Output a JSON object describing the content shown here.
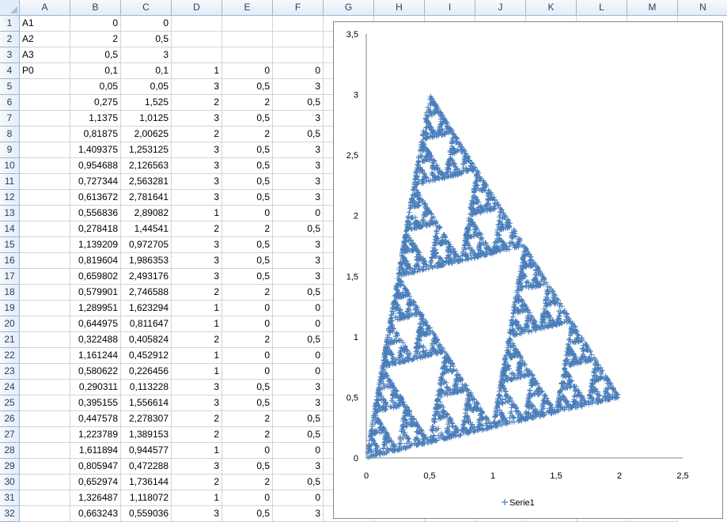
{
  "columns": [
    "A",
    "B",
    "C",
    "D",
    "E",
    "F",
    "G",
    "H",
    "I",
    "J",
    "K",
    "L",
    "M",
    "N"
  ],
  "rows": [
    [
      "A1",
      "0",
      "0",
      "",
      "",
      ""
    ],
    [
      "A2",
      "2",
      "0,5",
      "",
      "",
      ""
    ],
    [
      "A3",
      "0,5",
      "3",
      "",
      "",
      ""
    ],
    [
      "P0",
      "0,1",
      "0,1",
      "1",
      "0",
      "0"
    ],
    [
      "",
      "0,05",
      "0,05",
      "3",
      "0,5",
      "3"
    ],
    [
      "",
      "0,275",
      "1,525",
      "2",
      "2",
      "0,5"
    ],
    [
      "",
      "1,1375",
      "1,0125",
      "3",
      "0,5",
      "3"
    ],
    [
      "",
      "0,81875",
      "2,00625",
      "2",
      "2",
      "0,5"
    ],
    [
      "",
      "1,409375",
      "1,253125",
      "3",
      "0,5",
      "3"
    ],
    [
      "",
      "0,954688",
      "2,126563",
      "3",
      "0,5",
      "3"
    ],
    [
      "",
      "0,727344",
      "2,563281",
      "3",
      "0,5",
      "3"
    ],
    [
      "",
      "0,613672",
      "2,781641",
      "3",
      "0,5",
      "3"
    ],
    [
      "",
      "0,556836",
      "2,89082",
      "1",
      "0",
      "0"
    ],
    [
      "",
      "0,278418",
      "1,44541",
      "2",
      "2",
      "0,5"
    ],
    [
      "",
      "1,139209",
      "0,972705",
      "3",
      "0,5",
      "3"
    ],
    [
      "",
      "0,819604",
      "1,986353",
      "3",
      "0,5",
      "3"
    ],
    [
      "",
      "0,659802",
      "2,493176",
      "3",
      "0,5",
      "3"
    ],
    [
      "",
      "0,579901",
      "2,746588",
      "2",
      "2",
      "0,5"
    ],
    [
      "",
      "1,289951",
      "1,623294",
      "1",
      "0",
      "0"
    ],
    [
      "",
      "0,644975",
      "0,811647",
      "1",
      "0",
      "0"
    ],
    [
      "",
      "0,322488",
      "0,405824",
      "2",
      "2",
      "0,5"
    ],
    [
      "",
      "1,161244",
      "0,452912",
      "1",
      "0",
      "0"
    ],
    [
      "",
      "0,580622",
      "0,226456",
      "1",
      "0",
      "0"
    ],
    [
      "",
      "0,290311",
      "0,113228",
      "3",
      "0,5",
      "3"
    ],
    [
      "",
      "0,395155",
      "1,556614",
      "3",
      "0,5",
      "3"
    ],
    [
      "",
      "0,447578",
      "2,278307",
      "2",
      "2",
      "0,5"
    ],
    [
      "",
      "1,223789",
      "1,389153",
      "2",
      "2",
      "0,5"
    ],
    [
      "",
      "1,611894",
      "0,944577",
      "1",
      "0",
      "0"
    ],
    [
      "",
      "0,805947",
      "0,472288",
      "3",
      "0,5",
      "3"
    ],
    [
      "",
      "0,652974",
      "1,736144",
      "2",
      "2",
      "0,5"
    ],
    [
      "",
      "1,326487",
      "1,118072",
      "1",
      "0",
      "0"
    ],
    [
      "",
      "0,663243",
      "0,559036",
      "3",
      "0,5",
      "3"
    ]
  ],
  "chart_data": {
    "type": "scatter",
    "marker": "plus",
    "color": "#4a7ebb",
    "xlim": [
      0,
      2.5
    ],
    "ylim": [
      0,
      3.5
    ],
    "xticks": [
      "0",
      "0,5",
      "1",
      "1,5",
      "2",
      "2,5"
    ],
    "yticks": [
      "0",
      "0,5",
      "1",
      "1,5",
      "2",
      "2,5",
      "3",
      "3,5"
    ],
    "legend": "right-bottom",
    "series": [
      {
        "name": "Serie1",
        "vertices": [
          [
            0,
            0
          ],
          [
            2,
            0.5
          ],
          [
            0.5,
            3
          ]
        ],
        "start": [
          0.1,
          0.1
        ],
        "point_count": 5000,
        "sample_points": [
          [
            0.05,
            0.05
          ],
          [
            0.275,
            1.525
          ],
          [
            1.1375,
            1.0125
          ],
          [
            0.81875,
            2.00625
          ],
          [
            1.409375,
            1.253125
          ],
          [
            0.954688,
            2.126563
          ],
          [
            0.727344,
            2.563281
          ],
          [
            0.613672,
            2.781641
          ],
          [
            0.556836,
            2.89082
          ],
          [
            0.278418,
            1.44541
          ],
          [
            1.139209,
            0.972705
          ],
          [
            0.819604,
            1.986353
          ],
          [
            0.659802,
            2.493176
          ],
          [
            0.579901,
            2.746588
          ],
          [
            1.289951,
            1.623294
          ],
          [
            0.644975,
            0.811647
          ],
          [
            0.322488,
            0.405824
          ],
          [
            1.161244,
            0.452912
          ],
          [
            0.580622,
            0.226456
          ],
          [
            0.290311,
            0.113228
          ],
          [
            0.395155,
            1.556614
          ],
          [
            0.447578,
            2.278307
          ],
          [
            1.223789,
            1.389153
          ],
          [
            1.611894,
            0.944577
          ],
          [
            0.805947,
            0.472288
          ],
          [
            0.652974,
            1.736144
          ],
          [
            1.326487,
            1.118072
          ],
          [
            0.663243,
            0.559036
          ]
        ]
      }
    ]
  }
}
